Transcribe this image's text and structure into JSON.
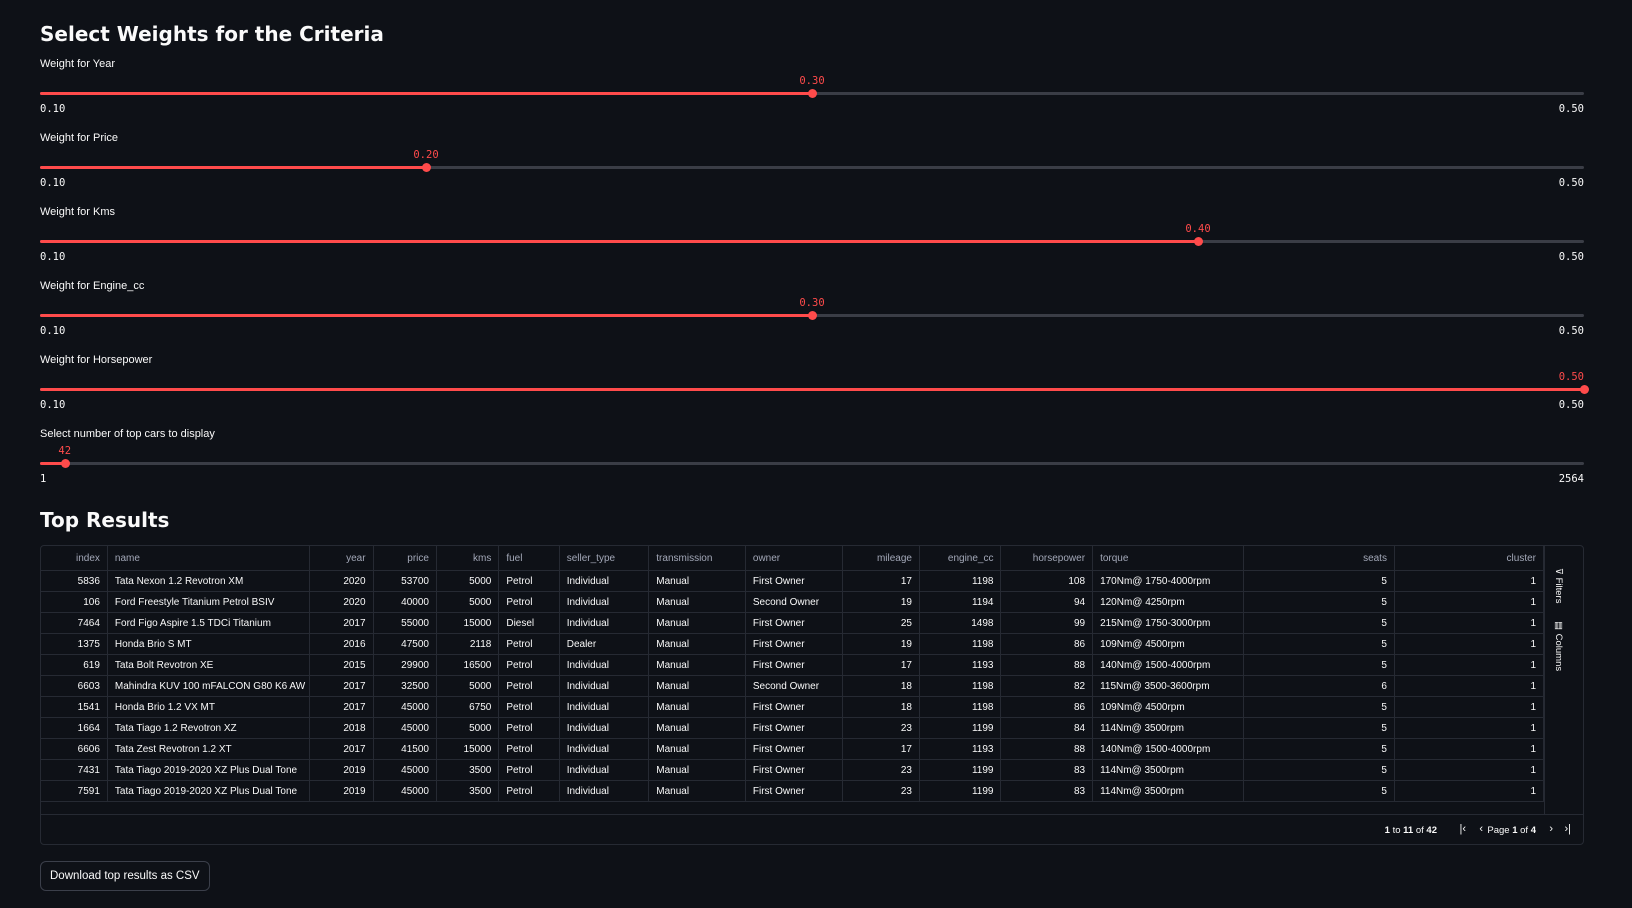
{
  "header": {
    "title": "Select Weights for the Criteria"
  },
  "sliders": [
    {
      "label": "Weight for Year",
      "value": "0.30",
      "min": "0.10",
      "max": "0.50",
      "fraction": 0.5
    },
    {
      "label": "Weight for Price",
      "value": "0.20",
      "min": "0.10",
      "max": "0.50",
      "fraction": 0.25
    },
    {
      "label": "Weight for Kms",
      "value": "0.40",
      "min": "0.10",
      "max": "0.50",
      "fraction": 0.75
    },
    {
      "label": "Weight for Engine_cc",
      "value": "0.30",
      "min": "0.10",
      "max": "0.50",
      "fraction": 0.5
    },
    {
      "label": "Weight for Horsepower",
      "value": "0.50",
      "min": "0.10",
      "max": "0.50",
      "fraction": 1.0
    },
    {
      "label": "Select number of top cars to display",
      "value": "42",
      "min": "1",
      "max": "2564",
      "fraction": 0.016
    }
  ],
  "results": {
    "title": "Top Results",
    "columns": [
      "index",
      "name",
      "year",
      "price",
      "kms",
      "fuel",
      "seller_type",
      "transmission",
      "owner",
      "mileage",
      "engine_cc",
      "horsepower",
      "torque",
      "seats",
      "cluster"
    ],
    "rows": [
      [
        "5836",
        "Tata Nexon 1.2 Revotron XM",
        "2020",
        "53700",
        "5000",
        "Petrol",
        "Individual",
        "Manual",
        "First Owner",
        "17",
        "1198",
        "108",
        "170Nm@ 1750-4000rpm",
        "5",
        "1"
      ],
      [
        "106",
        "Ford Freestyle Titanium Petrol BSIV",
        "2020",
        "40000",
        "5000",
        "Petrol",
        "Individual",
        "Manual",
        "Second Owner",
        "19",
        "1194",
        "94",
        "120Nm@ 4250rpm",
        "5",
        "1"
      ],
      [
        "7464",
        "Ford Figo Aspire 1.5 TDCi Titanium",
        "2017",
        "55000",
        "15000",
        "Diesel",
        "Individual",
        "Manual",
        "First Owner",
        "25",
        "1498",
        "99",
        "215Nm@ 1750-3000rpm",
        "5",
        "1"
      ],
      [
        "1375",
        "Honda Brio S MT",
        "2016",
        "47500",
        "2118",
        "Petrol",
        "Dealer",
        "Manual",
        "First Owner",
        "19",
        "1198",
        "86",
        "109Nm@ 4500rpm",
        "5",
        "1"
      ],
      [
        "619",
        "Tata Bolt Revotron XE",
        "2015",
        "29900",
        "16500",
        "Petrol",
        "Individual",
        "Manual",
        "First Owner",
        "17",
        "1193",
        "88",
        "140Nm@ 1500-4000rpm",
        "5",
        "1"
      ],
      [
        "6603",
        "Mahindra KUV 100 mFALCON G80 K6 AW",
        "2017",
        "32500",
        "5000",
        "Petrol",
        "Individual",
        "Manual",
        "Second Owner",
        "18",
        "1198",
        "82",
        "115Nm@ 3500-3600rpm",
        "6",
        "1"
      ],
      [
        "1541",
        "Honda Brio 1.2 VX MT",
        "2017",
        "45000",
        "6750",
        "Petrol",
        "Individual",
        "Manual",
        "First Owner",
        "18",
        "1198",
        "86",
        "109Nm@ 4500rpm",
        "5",
        "1"
      ],
      [
        "1664",
        "Tata Tiago 1.2 Revotron XZ",
        "2018",
        "45000",
        "5000",
        "Petrol",
        "Individual",
        "Manual",
        "First Owner",
        "23",
        "1199",
        "84",
        "114Nm@ 3500rpm",
        "5",
        "1"
      ],
      [
        "6606",
        "Tata Zest Revotron 1.2 XT",
        "2017",
        "41500",
        "15000",
        "Petrol",
        "Individual",
        "Manual",
        "First Owner",
        "17",
        "1193",
        "88",
        "140Nm@ 1500-4000rpm",
        "5",
        "1"
      ],
      [
        "7431",
        "Tata Tiago 2019-2020 XZ Plus Dual Tone",
        "2019",
        "45000",
        "3500",
        "Petrol",
        "Individual",
        "Manual",
        "First Owner",
        "23",
        "1199",
        "83",
        "114Nm@ 3500rpm",
        "5",
        "1"
      ],
      [
        "7591",
        "Tata Tiago 2019-2020 XZ Plus Dual Tone",
        "2019",
        "45000",
        "3500",
        "Petrol",
        "Individual",
        "Manual",
        "First Owner",
        "23",
        "1199",
        "83",
        "114Nm@ 3500rpm",
        "5",
        "1"
      ]
    ],
    "side_tabs": {
      "filters": "Filters",
      "columns": "Columns"
    },
    "pager": {
      "from": "1",
      "to": "11",
      "of_label": "of",
      "total": "42",
      "to_label": "to",
      "page_label": "Page",
      "page": "1",
      "page_of": "of",
      "pages": "4"
    }
  },
  "download_button": "Download top results as CSV",
  "colors": {
    "accent": "#ff4b4b",
    "background": "#0e1117",
    "track": "#3a3d46",
    "border": "#262a33"
  },
  "icons": [
    "filter-icon",
    "columns-icon",
    "first-page-icon",
    "prev-page-icon",
    "next-page-icon",
    "last-page-icon"
  ]
}
